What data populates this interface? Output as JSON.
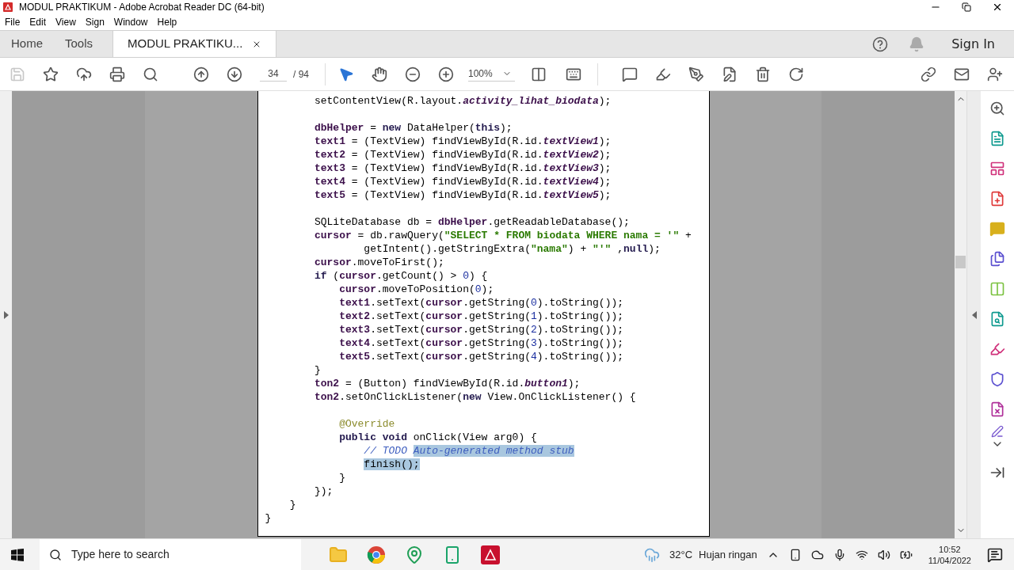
{
  "window": {
    "title": "MODUL PRAKTIKUM - Adobe Acrobat Reader DC (64-bit)"
  },
  "menu": [
    "File",
    "Edit",
    "View",
    "Sign",
    "Window",
    "Help"
  ],
  "tabs": [
    {
      "label": "Home",
      "selected": false,
      "closable": false
    },
    {
      "label": "Tools",
      "selected": false,
      "closable": false
    },
    {
      "label": "MODUL PRAKTIKU...",
      "selected": true,
      "closable": true
    }
  ],
  "sign_in": "Sign In",
  "toolbar": {
    "page": "34",
    "total": "/ 94",
    "zoom": "100%"
  },
  "document": {
    "blocks": [
      [
        [
          {
            "text": "        setContentView(R.layout.",
            "kind": "plain"
          },
          {
            "text": "activity_lihat_biodata",
            "kind": "constant"
          },
          {
            "text": ");",
            "kind": "plain"
          }
        ]
      ],
      [
        [
          {
            "text": "        dbHelper",
            "kind": "field"
          },
          {
            "text": " = ",
            "kind": "plain"
          },
          {
            "text": "new",
            "kind": "keyword"
          },
          {
            "text": " DataHelper(",
            "kind": "plain"
          },
          {
            "text": "this",
            "kind": "keyword"
          },
          {
            "text": ");",
            "kind": "plain"
          }
        ],
        [
          {
            "text": "        text1",
            "kind": "field"
          },
          {
            "text": " = (TextView) findViewById(R.id.",
            "kind": "plain"
          },
          {
            "text": "textView1",
            "kind": "constant"
          },
          {
            "text": ");",
            "kind": "plain"
          }
        ],
        [
          {
            "text": "        text2",
            "kind": "field"
          },
          {
            "text": " = (TextView) findViewById(R.id.",
            "kind": "plain"
          },
          {
            "text": "textView2",
            "kind": "constant"
          },
          {
            "text": ");",
            "kind": "plain"
          }
        ],
        [
          {
            "text": "        text3",
            "kind": "field"
          },
          {
            "text": " = (TextView) findViewById(R.id.",
            "kind": "plain"
          },
          {
            "text": "textView3",
            "kind": "constant"
          },
          {
            "text": ");",
            "kind": "plain"
          }
        ],
        [
          {
            "text": "        text4",
            "kind": "field"
          },
          {
            "text": " = (TextView) findViewById(R.id.",
            "kind": "plain"
          },
          {
            "text": "textView4",
            "kind": "constant"
          },
          {
            "text": ");",
            "kind": "plain"
          }
        ],
        [
          {
            "text": "        text5",
            "kind": "field"
          },
          {
            "text": " = (TextView) findViewById(R.id.",
            "kind": "plain"
          },
          {
            "text": "textView5",
            "kind": "constant"
          },
          {
            "text": ");",
            "kind": "plain"
          }
        ]
      ],
      [
        [
          {
            "text": "        SQLiteDatabase db = ",
            "kind": "plain"
          },
          {
            "text": "dbHelper",
            "kind": "field"
          },
          {
            "text": ".getReadableDatabase();",
            "kind": "plain"
          }
        ],
        [
          {
            "text": "        cursor",
            "kind": "field"
          },
          {
            "text": " = db.rawQuery(",
            "kind": "plain"
          },
          {
            "text": "\"SELECT * FROM biodata WHERE nama = '\"",
            "kind": "string"
          },
          {
            "text": " +",
            "kind": "plain"
          }
        ],
        [
          {
            "text": "                getIntent().getStringExtra(",
            "kind": "plain"
          },
          {
            "text": "\"nama\"",
            "kind": "string"
          },
          {
            "text": ") + ",
            "kind": "plain"
          },
          {
            "text": "\"'\"",
            "kind": "string"
          },
          {
            "text": " ,",
            "kind": "plain"
          },
          {
            "text": "null",
            "kind": "keyword"
          },
          {
            "text": ");",
            "kind": "plain"
          }
        ],
        [
          {
            "text": "        cursor",
            "kind": "field"
          },
          {
            "text": ".moveToFirst();",
            "kind": "plain"
          }
        ],
        [
          {
            "text": "        if",
            "kind": "keyword"
          },
          {
            "text": " (",
            "kind": "plain"
          },
          {
            "text": "cursor",
            "kind": "field"
          },
          {
            "text": ".getCount() > ",
            "kind": "plain"
          },
          {
            "text": "0",
            "kind": "number"
          },
          {
            "text": ") {",
            "kind": "plain"
          }
        ],
        [
          {
            "text": "            cursor",
            "kind": "field"
          },
          {
            "text": ".moveToPosition(",
            "kind": "plain"
          },
          {
            "text": "0",
            "kind": "number"
          },
          {
            "text": ");",
            "kind": "plain"
          }
        ],
        [
          {
            "text": "            text1",
            "kind": "field"
          },
          {
            "text": ".setText(",
            "kind": "plain"
          },
          {
            "text": "cursor",
            "kind": "field"
          },
          {
            "text": ".getString(",
            "kind": "plain"
          },
          {
            "text": "0",
            "kind": "number"
          },
          {
            "text": ").toString());",
            "kind": "plain"
          }
        ],
        [
          {
            "text": "            text2",
            "kind": "field"
          },
          {
            "text": ".setText(",
            "kind": "plain"
          },
          {
            "text": "cursor",
            "kind": "field"
          },
          {
            "text": ".getString(",
            "kind": "plain"
          },
          {
            "text": "1",
            "kind": "number"
          },
          {
            "text": ").toString());",
            "kind": "plain"
          }
        ],
        [
          {
            "text": "            text3",
            "kind": "field"
          },
          {
            "text": ".setText(",
            "kind": "plain"
          },
          {
            "text": "cursor",
            "kind": "field"
          },
          {
            "text": ".getString(",
            "kind": "plain"
          },
          {
            "text": "2",
            "kind": "number"
          },
          {
            "text": ").toString());",
            "kind": "plain"
          }
        ],
        [
          {
            "text": "            text4",
            "kind": "field"
          },
          {
            "text": ".setText(",
            "kind": "plain"
          },
          {
            "text": "cursor",
            "kind": "field"
          },
          {
            "text": ".getString(",
            "kind": "plain"
          },
          {
            "text": "3",
            "kind": "number"
          },
          {
            "text": ").toString());",
            "kind": "plain"
          }
        ],
        [
          {
            "text": "            text5",
            "kind": "field"
          },
          {
            "text": ".setText(",
            "kind": "plain"
          },
          {
            "text": "cursor",
            "kind": "field"
          },
          {
            "text": ".getString(",
            "kind": "plain"
          },
          {
            "text": "4",
            "kind": "number"
          },
          {
            "text": ").toString());",
            "kind": "plain"
          }
        ],
        [
          {
            "text": "        }",
            "kind": "plain"
          }
        ],
        [
          {
            "text": "        ton2",
            "kind": "field"
          },
          {
            "text": " = (Button) findViewById(R.id.",
            "kind": "plain"
          },
          {
            "text": "button1",
            "kind": "constant"
          },
          {
            "text": ");",
            "kind": "plain"
          }
        ],
        [
          {
            "text": "        ton2",
            "kind": "field"
          },
          {
            "text": ".setOnClickListener(",
            "kind": "plain"
          },
          {
            "text": "new",
            "kind": "keyword"
          },
          {
            "text": " View.OnClickListener() {",
            "kind": "plain"
          }
        ]
      ],
      [
        [
          {
            "text": "            @Override",
            "kind": "annotation"
          }
        ],
        [
          {
            "text": "            public void",
            "kind": "keyword"
          },
          {
            "text": " onClick(View arg0) {",
            "kind": "plain"
          }
        ],
        [
          {
            "text": "                // TODO ",
            "kind": "comment"
          },
          {
            "text": "Auto-generated method stub",
            "kind": "comment-selected"
          }
        ],
        [
          {
            "text": "                finish();",
            "kind": "plain-selected"
          }
        ],
        [
          {
            "text": "            }",
            "kind": "plain"
          }
        ],
        [
          {
            "text": "        });",
            "kind": "plain"
          }
        ],
        [
          {
            "text": "    }",
            "kind": "plain"
          }
        ],
        [
          {
            "text": "}",
            "kind": "plain"
          }
        ]
      ]
    ]
  },
  "taskbar": {
    "search_placeholder": "Type here to search",
    "temperature": "32°C",
    "weather": "Hujan ringan",
    "time": "10:52",
    "date": "11/04/2022"
  }
}
